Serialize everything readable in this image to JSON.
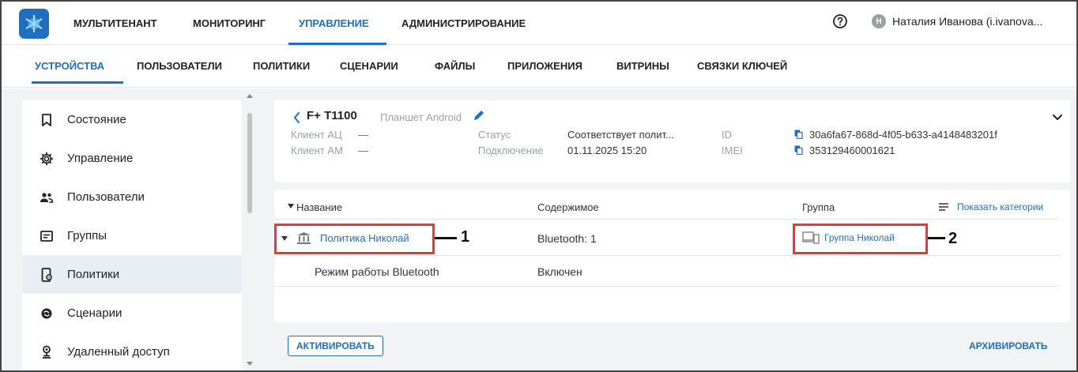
{
  "topnav": {
    "items": [
      "МУЛЬТИТЕНАНТ",
      "МОНИТОРИНГ",
      "УПРАВЛЕНИЕ",
      "АДМИНИСТРИРОВАНИЕ"
    ],
    "active": "УПРАВЛЕНИЕ",
    "user_initial": "Н",
    "user_name": "Наталия Иванова (i.ivanova..."
  },
  "subnav": {
    "items": [
      "УСТРОЙСТВА",
      "ПОЛЬЗОВАТЕЛИ",
      "ПОЛИТИКИ",
      "СЦЕНАРИИ",
      "ФАЙЛЫ",
      "ПРИЛОЖЕНИЯ",
      "ВИТРИНЫ",
      "СВЯЗКИ КЛЮЧЕЙ"
    ],
    "active": "УСТРОЙСТВА"
  },
  "sidebar": {
    "items": [
      {
        "label": "Состояние",
        "icon": "bookmark-icon"
      },
      {
        "label": "Управление",
        "icon": "gear-icon"
      },
      {
        "label": "Пользователи",
        "icon": "users-icon"
      },
      {
        "label": "Группы",
        "icon": "folder-icon"
      },
      {
        "label": "Политики",
        "icon": "policy-phone-icon"
      },
      {
        "label": "Сценарии",
        "icon": "scenario-icon"
      },
      {
        "label": "Удаленный доступ",
        "icon": "remote-access-icon"
      }
    ],
    "active": "Политики"
  },
  "device": {
    "name": "F+ T1100",
    "type": "Планшет Android",
    "fields": {
      "client_ac_label": "Клиент АЦ",
      "client_ac_value": "—",
      "client_am_label": "Клиент AM",
      "client_am_value": "—",
      "status_label": "Статус",
      "status_value": "Соответствует полит...",
      "connection_label": "Подключение",
      "connection_value": "01.11.2025 15:20",
      "id_label": "ID",
      "id_value": "30a6fa67-868d-4f05-b633-a4148483201f",
      "imei_label": "IMEI",
      "imei_value": "353129460001621"
    }
  },
  "table": {
    "col_name": "Название",
    "col_content": "Содержимое",
    "col_group": "Группа",
    "show_categories": "Показать категории",
    "rows": [
      {
        "name": "Политика Николай",
        "content": "Bluetooth: 1",
        "group": "Группа Николай"
      },
      {
        "name": "Режим работы Bluetooth",
        "content": "Включен",
        "group": ""
      }
    ]
  },
  "callouts": [
    "1",
    "2"
  ],
  "actions": {
    "activate": "АКТИВИРОВАТЬ",
    "archive": "АРХИВИРОВАТЬ"
  },
  "colors": {
    "accent": "#1e6fbf",
    "highlight": "#e53935"
  }
}
